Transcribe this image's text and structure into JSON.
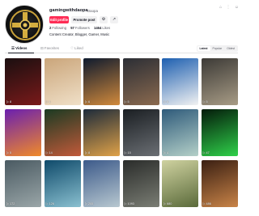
{
  "profile": {
    "username": "gamingwithdaopa",
    "nickname": "Daopa",
    "bio": "Content Creator, Blogger, Gamer, Music",
    "avatar_icon": "golden-cross-emblem-icon"
  },
  "actions": {
    "edit_profile": "Edit profile",
    "promote_post": "Promote post",
    "settings_icon": "⚙",
    "share_icon": "↗"
  },
  "stats": [
    {
      "value": "2",
      "label": "Following"
    },
    {
      "value": "57",
      "label": "Followers"
    },
    {
      "value": "1464",
      "label": "Likes"
    }
  ],
  "top_icons": [
    "⌂",
    "⋮",
    "☺"
  ],
  "tabs": [
    {
      "label": "Videos",
      "icon": "☰",
      "active": true
    },
    {
      "label": "Favorites",
      "icon": "⊟",
      "active": false
    },
    {
      "label": "Liked",
      "icon": "♡",
      "active": false
    }
  ],
  "sort": [
    {
      "label": "Latest",
      "active": true
    },
    {
      "label": "Popular",
      "active": false
    },
    {
      "label": "Oldest",
      "active": false
    }
  ],
  "videos": [
    {
      "views": "8",
      "colors": [
        "#1a0f10",
        "#7a1a1a"
      ]
    },
    {
      "views": "1",
      "colors": [
        "#caa57a",
        "#f0e0c8"
      ]
    },
    {
      "views": "6",
      "colors": [
        "#0e1a2e",
        "#d28a3c"
      ]
    },
    {
      "views": "5",
      "colors": [
        "#2b2e35",
        "#8b6a4f"
      ]
    },
    {
      "views": "6",
      "colors": [
        "#1d5fb0",
        "#f2f2f2"
      ]
    },
    {
      "views": "5",
      "colors": [
        "#3c3a36",
        "#a89c86"
      ]
    },
    {
      "views": "5",
      "colors": [
        "#6a1fb0",
        "#f08a2a"
      ]
    },
    {
      "views": "14",
      "colors": [
        "#1a3a22",
        "#c25a3a"
      ]
    },
    {
      "views": "8",
      "colors": [
        "#1c2a3a",
        "#e0a248"
      ]
    },
    {
      "views": "15",
      "colors": [
        "#1a1e22",
        "#6b6f74"
      ]
    },
    {
      "views": "4",
      "colors": [
        "#2e5a7a",
        "#b4d0c8"
      ]
    },
    {
      "views": "47",
      "colors": [
        "#041a0a",
        "#2fd14a"
      ]
    },
    {
      "views": "172",
      "colors": [
        "#4a5a62",
        "#9aa6a8"
      ]
    },
    {
      "views": "126",
      "colors": [
        "#0f4a6a",
        "#8ac0d0"
      ]
    },
    {
      "views": "205",
      "colors": [
        "#3c5a8a",
        "#b8c8d0"
      ]
    },
    {
      "views": "1093",
      "colors": [
        "#2a2c2a",
        "#7a7d74"
      ]
    },
    {
      "views": "680",
      "colors": [
        "#cfd2a0",
        "#5a6a3a"
      ]
    },
    {
      "views": "486",
      "colors": [
        "#3a1f12",
        "#c98448"
      ]
    }
  ]
}
